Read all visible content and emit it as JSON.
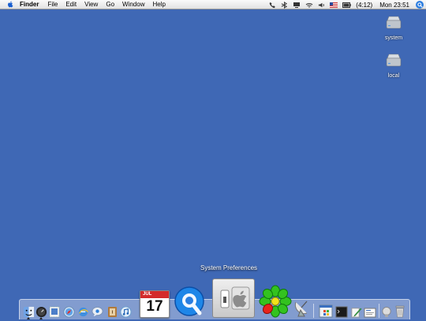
{
  "menubar": {
    "app_name": "Finder",
    "items": [
      "File",
      "Edit",
      "View",
      "Go",
      "Window",
      "Help"
    ],
    "battery_text": "(4:12)",
    "clock": "Mon 23:51"
  },
  "desktop": {
    "icons": [
      {
        "label": "system"
      },
      {
        "label": "local"
      }
    ]
  },
  "dock": {
    "tooltip": "System Preferences",
    "calendar_date": "17",
    "calendar_month": "JUL"
  },
  "colors": {
    "desktop": "#3f68b5",
    "accent": "#2f7fe0"
  }
}
